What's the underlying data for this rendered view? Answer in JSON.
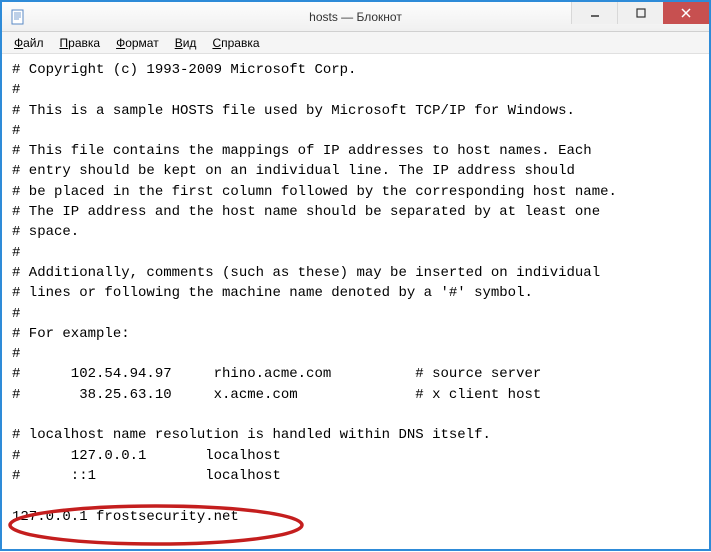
{
  "window": {
    "title": "hosts — Блокнот"
  },
  "menu": {
    "file": "Файл",
    "edit": "Правка",
    "format": "Формат",
    "view": "Вид",
    "help": "Справка"
  },
  "content": {
    "text": "# Copyright (c) 1993-2009 Microsoft Corp.\n#\n# This is a sample HOSTS file used by Microsoft TCP/IP for Windows.\n#\n# This file contains the mappings of IP addresses to host names. Each\n# entry should be kept on an individual line. The IP address should\n# be placed in the first column followed by the corresponding host name.\n# The IP address and the host name should be separated by at least one\n# space.\n#\n# Additionally, comments (such as these) may be inserted on individual\n# lines or following the machine name denoted by a '#' symbol.\n#\n# For example:\n#\n#      102.54.94.97     rhino.acme.com          # source server\n#       38.25.63.10     x.acme.com              # x client host\n\n# localhost name resolution is handled within DNS itself.\n#      127.0.0.1       localhost\n#      ::1             localhost\n\n127.0.0.1 frostsecurity.net"
  }
}
